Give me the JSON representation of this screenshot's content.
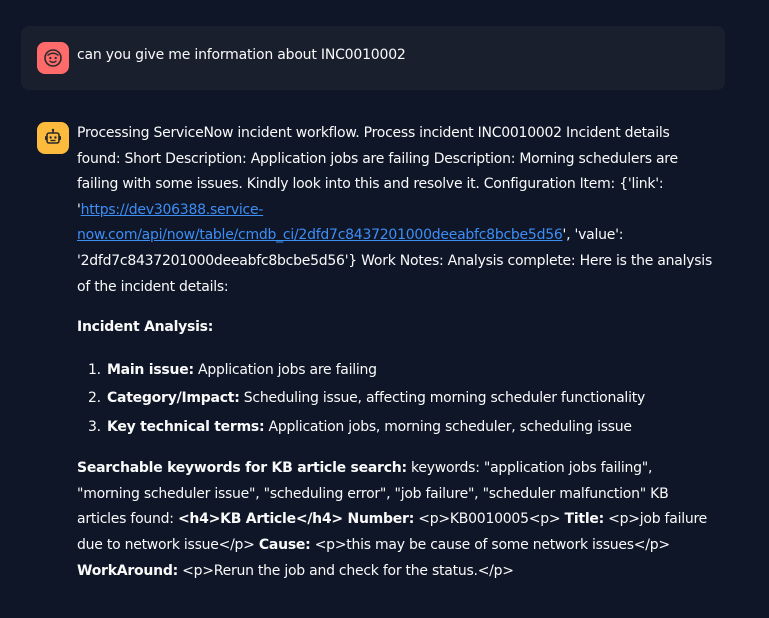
{
  "user_message": {
    "text": "can you give me information about INC0010002"
  },
  "bot_message": {
    "intro": "Processing ServiceNow incident workflow. Process incident INC0010002 Incident details found: Short Description: Application jobs are failing Description: Morning schedulers are failing with some issues. Kindly look into this and resolve it. Configuration Item: {'link': '",
    "link_text": "https://dev306388.service-now.com/api/now/table/cmdb_ci/2dfd7c8437201000deeabfc8bcbe5d56",
    "after_link": "', 'value': '2dfd7c8437201000deeabfc8bcbe5d56'} Work Notes: Analysis complete: Here is the analysis of the incident details:",
    "analysis_heading": "Incident Analysis:",
    "analysis_items": [
      {
        "label": "Main issue:",
        "text": " Application jobs are failing"
      },
      {
        "label": "Category/Impact:",
        "text": " Scheduling issue, affecting morning scheduler functionality"
      },
      {
        "label": "Key technical terms:",
        "text": " Application jobs, morning scheduler, scheduling issue"
      }
    ],
    "kb": {
      "search_label": "Searchable keywords for KB article search:",
      "search_text": " keywords: \"application jobs failing\", \"morning scheduler issue\", \"scheduling error\", \"job failure\", \"scheduler malfunction\" KB articles found: ",
      "article_label": "<h4>KB Article</h4> Number:",
      "number_text": " <p>KB0010005<p> ",
      "title_label": "Title:",
      "title_text": " <p>job failure due to network issue</p> ",
      "cause_label": "Cause:",
      "cause_text": " <p>this may be cause of some network issues</p> ",
      "workaround_label": "WorkAround:",
      "workaround_text": " <p>Rerun the job and check for the status.</p>"
    }
  }
}
